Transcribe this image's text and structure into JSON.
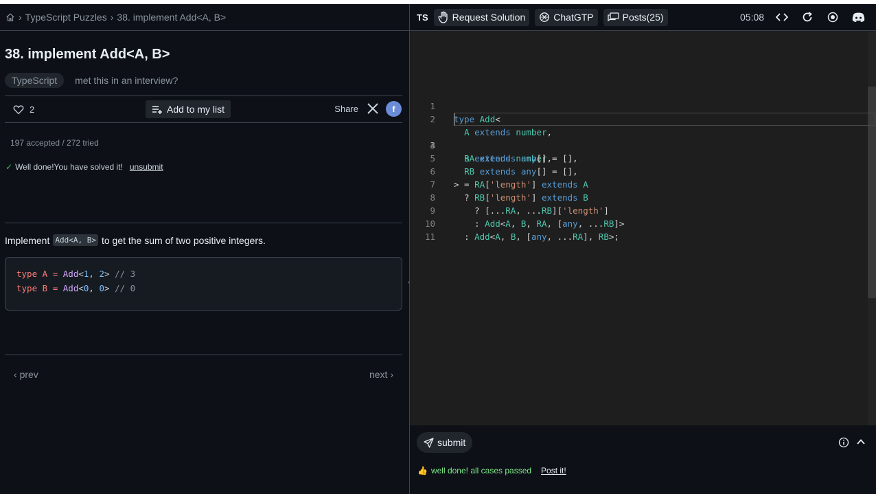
{
  "breadcrumb": {
    "section": "TypeScript Puzzles",
    "current": "38. implement Add<A, B>"
  },
  "problem": {
    "title": "38. implement Add<A, B>",
    "tag": "TypeScript",
    "interview_link": "met this in an interview?",
    "likes": "2",
    "add_to_list": "Add to my list",
    "share": "Share",
    "stats": "197 accepted / 272 tried",
    "status": "Well done!You have solved it!",
    "unsubmit": "unsubmit",
    "desc_prefix": "Implement",
    "desc_code": "Add<A, B>",
    "desc_suffix": "to get the sum of two positive integers.",
    "example_lines": [
      {
        "kw": "type",
        "name": "A",
        "fn": "Add",
        "a": "1",
        "b": "2",
        "comment": "// 3"
      },
      {
        "kw": "type",
        "name": "B",
        "fn": "Add",
        "a": "0",
        "b": "0",
        "comment": "// 0"
      }
    ],
    "prev": "prev",
    "next": "next"
  },
  "toolbar": {
    "lang": "TS",
    "request_solution": "Request Solution",
    "chatgpt": "ChatGTP",
    "posts": "Posts(25)",
    "timer": "05:08"
  },
  "editor": {
    "line_numbers": [
      "1",
      "2",
      "3",
      "4",
      "5",
      "6",
      "7",
      "8",
      "9",
      "10",
      "11"
    ],
    "lines": [
      "type Add<",
      "  A extends number,",
      "  B extends number,",
      "  RA extends any[] = [],",
      "  RB extends any[] = [],",
      "> = RA['length'] extends A",
      "  ? RB['length'] extends B",
      "    ? [...RA, ...RB]['length']",
      "    : Add<A, B, RA, [any, ...RB]>",
      "  : Add<A, B, [any, ...RA], RB>;",
      ""
    ]
  },
  "bottom": {
    "submit": "submit",
    "result": "well done! all cases passed",
    "post_it": "Post it!"
  },
  "colors": {
    "accent_ok": "#7ee787",
    "keyword": "#569cd6",
    "type": "#4ec9b0",
    "string": "#ce9178"
  }
}
